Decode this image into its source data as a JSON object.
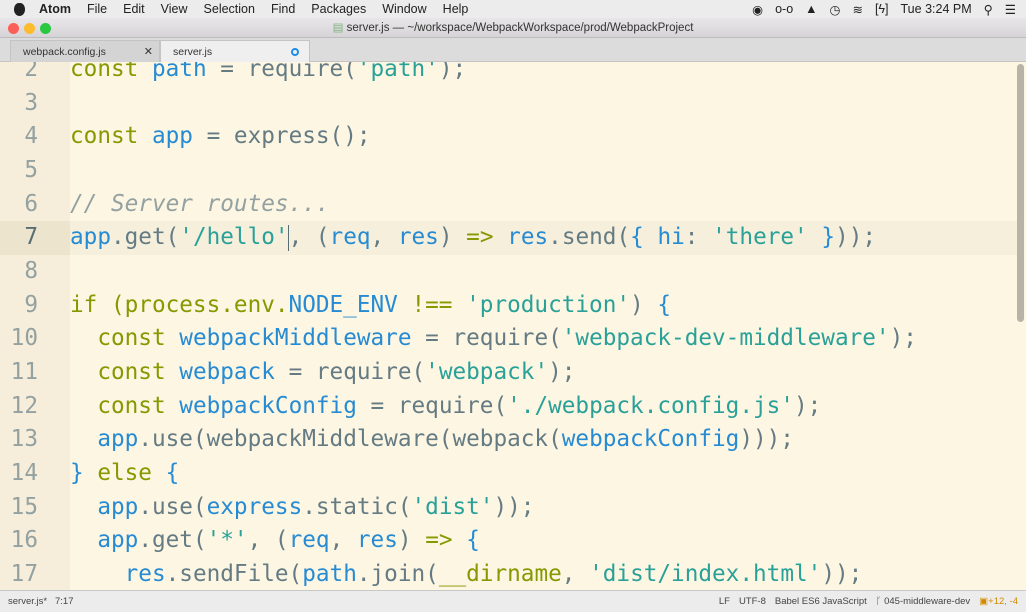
{
  "menubar": {
    "app": "Atom",
    "items": [
      "File",
      "Edit",
      "View",
      "Selection",
      "Find",
      "Packages",
      "Window",
      "Help"
    ],
    "clock": "Tue 3:24 PM",
    "status_icons": [
      "record-icon",
      "glasses-icon",
      "drive-icon",
      "timer-icon",
      "wifi-icon",
      "battery-charging-icon",
      "spotlight-search-icon",
      "notification-center-icon"
    ]
  },
  "window": {
    "title": "server.js — ~/workspace/WebpackWorkspace/prod/WebpackProject"
  },
  "tabs": [
    {
      "label": "webpack.config.js",
      "active": false
    },
    {
      "label": "server.js",
      "active": true,
      "modified": true
    }
  ],
  "editor": {
    "theme_colors": {
      "background": "#fdf6e3",
      "keyword": "#859900",
      "variable": "#268bd2",
      "string": "#2aa198",
      "plain": "#657b83",
      "comment": "#93a1a1"
    },
    "cursor_line": 7,
    "lines": [
      {
        "n": "2",
        "t": [
          [
            "k",
            "const"
          ],
          [
            "p",
            " "
          ],
          [
            "v",
            "path"
          ],
          [
            "p",
            " = require("
          ],
          [
            "s",
            "'path'"
          ],
          [
            "p",
            ");"
          ]
        ]
      },
      {
        "n": "3",
        "t": []
      },
      {
        "n": "4",
        "t": [
          [
            "k",
            "const"
          ],
          [
            "p",
            " "
          ],
          [
            "v",
            "app"
          ],
          [
            "p",
            " = express();"
          ]
        ]
      },
      {
        "n": "5",
        "t": []
      },
      {
        "n": "6",
        "t": [
          [
            "c",
            "// Server routes..."
          ]
        ]
      },
      {
        "n": "7",
        "t": [
          [
            "v",
            "app"
          ],
          [
            "p",
            ".get("
          ],
          [
            "s",
            "'/hello'"
          ],
          [
            "caret",
            ""
          ],
          [
            "p",
            ", ("
          ],
          [
            "v",
            "req"
          ],
          [
            "p",
            ", "
          ],
          [
            "v",
            "res"
          ],
          [
            "p",
            ") "
          ],
          [
            "k",
            "=>"
          ],
          [
            "p",
            " "
          ],
          [
            "v",
            "res"
          ],
          [
            "p",
            ".send("
          ],
          [
            "v",
            "{ hi"
          ],
          [
            "p",
            ": "
          ],
          [
            "s",
            "'there'"
          ],
          [
            "v",
            " }"
          ],
          [
            "p",
            "));"
          ]
        ]
      },
      {
        "n": "8",
        "t": []
      },
      {
        "n": "9",
        "t": [
          [
            "k",
            "if (process.env."
          ],
          [
            "v",
            "NODE_ENV"
          ],
          [
            "k",
            " !== "
          ],
          [
            "s",
            "'production'"
          ],
          [
            "p",
            ") "
          ],
          [
            "v",
            "{"
          ]
        ]
      },
      {
        "n": "10",
        "t": [
          [
            "p",
            "  "
          ],
          [
            "k",
            "const"
          ],
          [
            "p",
            " "
          ],
          [
            "v",
            "webpackMiddleware"
          ],
          [
            "p",
            " = require("
          ],
          [
            "s",
            "'webpack-dev-middleware'"
          ],
          [
            "p",
            ");"
          ]
        ]
      },
      {
        "n": "11",
        "t": [
          [
            "p",
            "  "
          ],
          [
            "k",
            "const"
          ],
          [
            "p",
            " "
          ],
          [
            "v",
            "webpack"
          ],
          [
            "p",
            " = require("
          ],
          [
            "s",
            "'webpack'"
          ],
          [
            "p",
            ");"
          ]
        ]
      },
      {
        "n": "12",
        "t": [
          [
            "p",
            "  "
          ],
          [
            "k",
            "const"
          ],
          [
            "p",
            " "
          ],
          [
            "v",
            "webpackConfig"
          ],
          [
            "p",
            " = require("
          ],
          [
            "s",
            "'./webpack.config.js'"
          ],
          [
            "p",
            ");"
          ]
        ]
      },
      {
        "n": "13",
        "t": [
          [
            "p",
            "  "
          ],
          [
            "v",
            "app"
          ],
          [
            "p",
            ".use(webpackMiddleware(webpack("
          ],
          [
            "v",
            "webpackConfig"
          ],
          [
            "p",
            ")));"
          ]
        ]
      },
      {
        "n": "14",
        "t": [
          [
            "v",
            "}"
          ],
          [
            "k",
            " else "
          ],
          [
            "v",
            "{"
          ]
        ]
      },
      {
        "n": "15",
        "t": [
          [
            "p",
            "  "
          ],
          [
            "v",
            "app"
          ],
          [
            "p",
            ".use("
          ],
          [
            "v",
            "express"
          ],
          [
            "p",
            ".static("
          ],
          [
            "s",
            "'dist'"
          ],
          [
            "p",
            "));"
          ]
        ]
      },
      {
        "n": "16",
        "t": [
          [
            "p",
            "  "
          ],
          [
            "v",
            "app"
          ],
          [
            "p",
            ".get("
          ],
          [
            "s",
            "'*'"
          ],
          [
            "p",
            ", ("
          ],
          [
            "v",
            "req"
          ],
          [
            "p",
            ", "
          ],
          [
            "v",
            "res"
          ],
          [
            "p",
            ") "
          ],
          [
            "k",
            "=>"
          ],
          [
            "p",
            " "
          ],
          [
            "v",
            "{"
          ]
        ]
      },
      {
        "n": "17",
        "t": [
          [
            "p",
            "    "
          ],
          [
            "v",
            "res"
          ],
          [
            "p",
            ".sendFile("
          ],
          [
            "v",
            "path"
          ],
          [
            "p",
            ".join("
          ],
          [
            "k",
            "__dirname"
          ],
          [
            "p",
            ", "
          ],
          [
            "s",
            "'dist/index.html'"
          ],
          [
            "p",
            "));"
          ]
        ]
      }
    ]
  },
  "statusbar": {
    "file": "server.js*",
    "position": "7:17",
    "line_ending": "LF",
    "encoding": "UTF-8",
    "grammar": "Babel ES6 JavaScript",
    "branch": "045-middleware-dev",
    "git_diff": "+12, -4"
  }
}
